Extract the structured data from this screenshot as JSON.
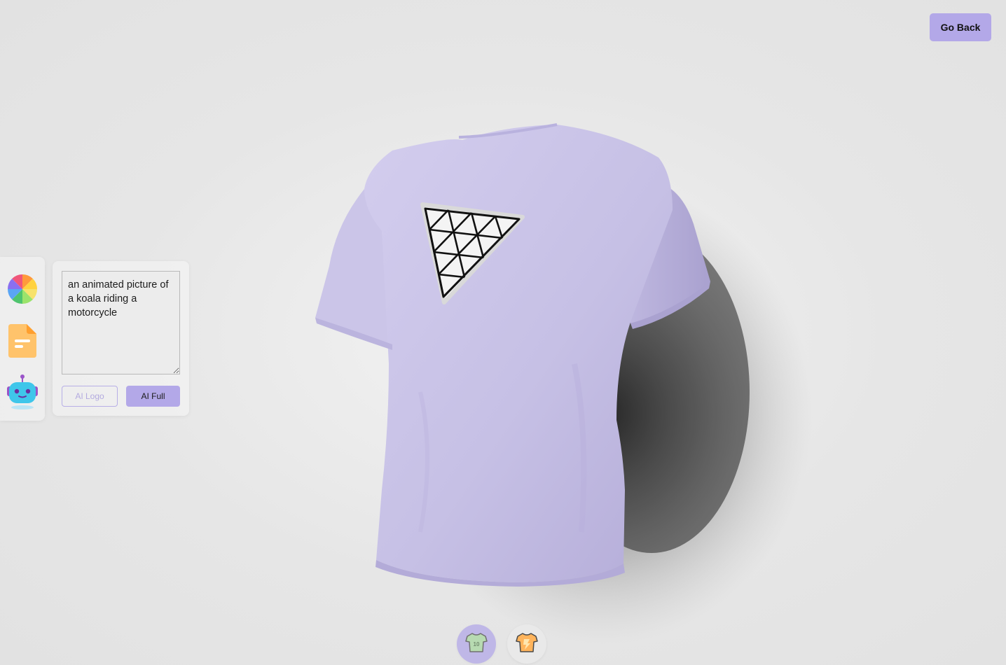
{
  "header": {
    "go_back_label": "Go Back"
  },
  "theme": {
    "accent": "#b3a8e8",
    "shirt_color": "#c8c2e6",
    "background": "#e4e4e4"
  },
  "sidebar": {
    "tools": [
      {
        "name": "color-picker",
        "icon": "color-wheel-icon"
      },
      {
        "name": "file-picker",
        "icon": "file-icon"
      },
      {
        "name": "ai-picker",
        "icon": "robot-icon"
      }
    ]
  },
  "ai_panel": {
    "prompt_value": "an animated picture of a koala riding a motorcycle",
    "logo_button_label": "AI Logo",
    "full_button_label": "AI Full"
  },
  "bottom_tabs": [
    {
      "name": "logo-shirt",
      "icon": "logo-shirt-icon",
      "badge": "10",
      "active": true
    },
    {
      "name": "stylish-shirt",
      "icon": "stylish-shirt-icon",
      "active": false
    }
  ]
}
